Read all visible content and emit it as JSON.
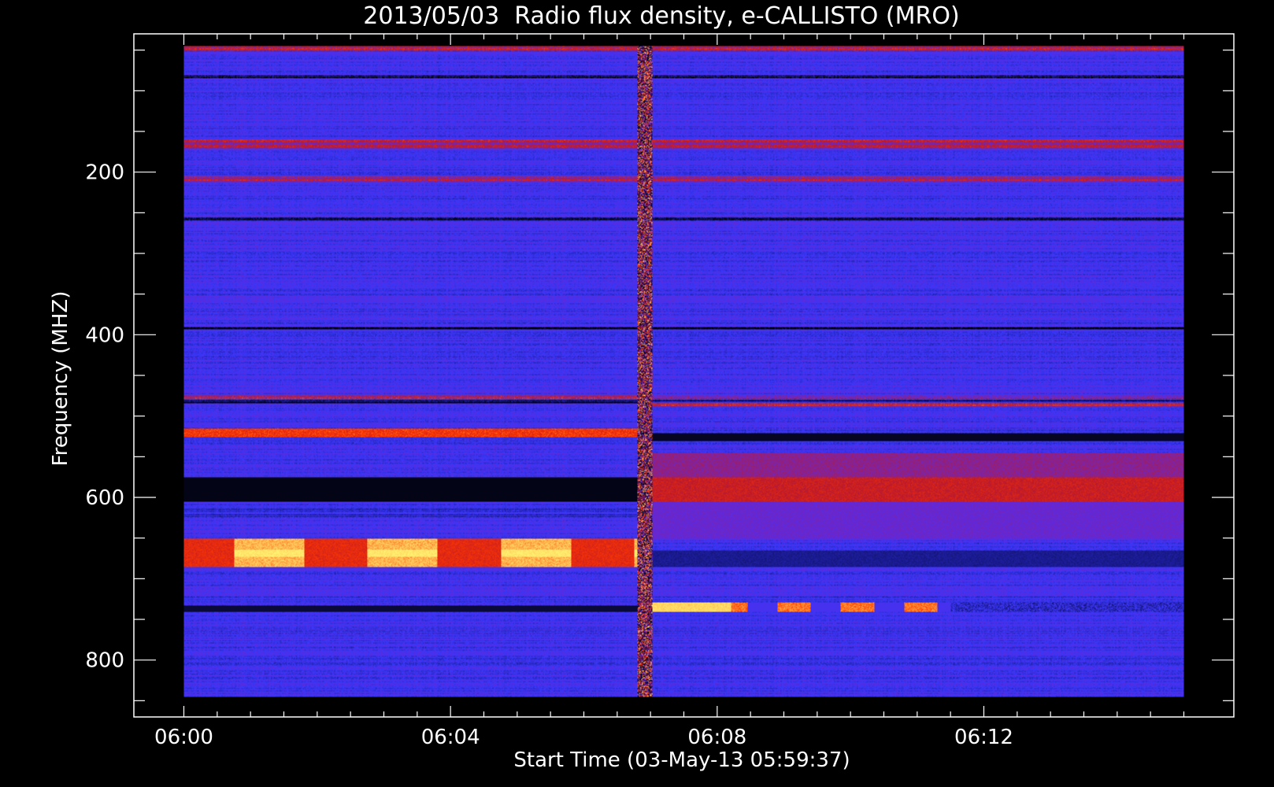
{
  "chart_data": {
    "type": "heatmap",
    "title": "2013/05/03  Radio flux density, e-CALLISTO (MRO)",
    "xlabel": "Start Time (03-May-13 05:59:37)",
    "ylabel": "Frequency (MHZ)",
    "x_tick_labels": [
      "06:00",
      "06:04",
      "06:08",
      "06:12"
    ],
    "x_tick_minutes": [
      0,
      4,
      8,
      12
    ],
    "y_tick_labels": [
      "200",
      "400",
      "600",
      "800"
    ],
    "y_tick_values": [
      200,
      400,
      600,
      800
    ],
    "xlim_minutes": [
      -0.75,
      15.75
    ],
    "ylim_mhz": [
      870,
      30
    ],
    "data_extent": {
      "time_minutes": [
        0,
        15
      ],
      "freq_mhz": [
        45,
        845
      ]
    },
    "event_minute": 6.8,
    "colormap": [
      "#000000",
      "#1a1aa8",
      "#3b3bff",
      "#7a2bd0",
      "#c81414",
      "#ff3a00",
      "#ffd060",
      "#ffff70"
    ],
    "grid": false,
    "features": [
      {
        "label": "pre-event bright band",
        "freq_mhz": [
          650,
          685
        ],
        "time_minutes": [
          0,
          6.8
        ],
        "level": "high"
      },
      {
        "label": "pre-event red band",
        "freq_mhz": [
          515,
          525
        ],
        "time_minutes": [
          0,
          6.8
        ],
        "level": "medium-high"
      },
      {
        "label": "pre-event dark band",
        "freq_mhz": [
          575,
          605
        ],
        "time_minutes": [
          0,
          6.8
        ],
        "level": "low"
      },
      {
        "label": "post-event red block",
        "freq_mhz": [
          575,
          605
        ],
        "time_minutes": [
          7.0,
          15
        ],
        "level": "medium-high"
      },
      {
        "label": "post-event dark band",
        "freq_mhz": [
          520,
          530
        ],
        "time_minutes": [
          7.0,
          15
        ],
        "level": "low"
      },
      {
        "label": "post-event bright band",
        "freq_mhz": [
          728,
          740
        ],
        "time_minutes": [
          6.8,
          11.5
        ],
        "level": "high"
      }
    ]
  }
}
